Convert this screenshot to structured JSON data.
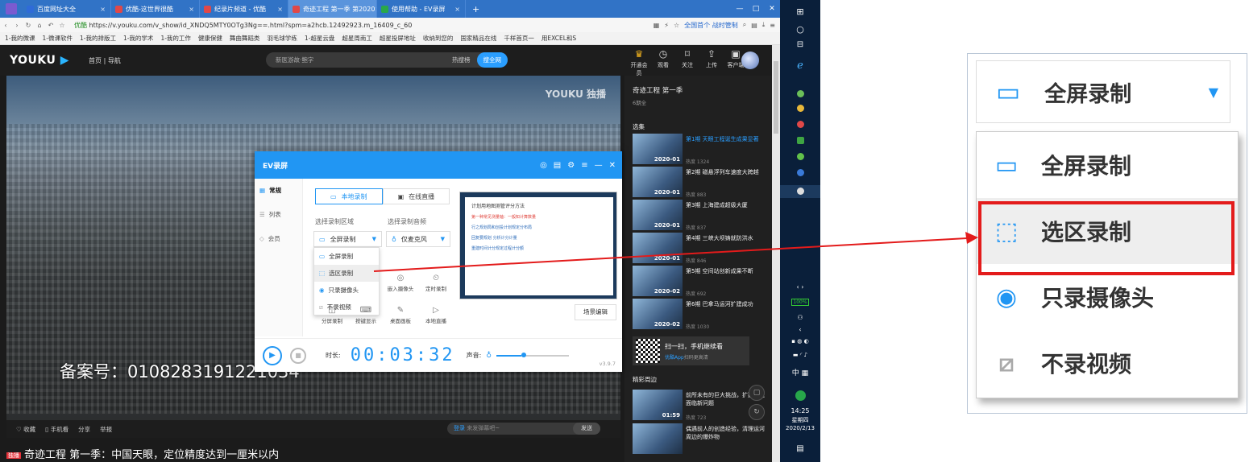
{
  "browser": {
    "tabs": [
      {
        "label": "百度网址大全",
        "color": "#2f6bd8",
        "active": false
      },
      {
        "label": "优酷-这世界很酷",
        "color": "#e04848",
        "active": false
      },
      {
        "label": "纪录片频道 - 优酷",
        "color": "#e04848",
        "active": false
      },
      {
        "label": "奇迹工程 第一季 第2020",
        "color": "#e04848",
        "active": true
      },
      {
        "label": "使用帮助 - EV录屏",
        "color": "#2aa84a",
        "active": false
      }
    ],
    "new_tab": "+",
    "url_prefix": "优酷",
    "url": "https://v.youku.com/v_show/id_XNDQ5MTY0OTg3Ng==.html?spm=a2hcb.12492923.m_16409_c_60",
    "cast_label": "全国首个 战时管制",
    "bookmarks": [
      "1-我的微课",
      "1-微课软件",
      "1-我的排版工",
      "1-我的学术",
      "1-我的工作",
      "健康保健",
      "舞曲舞蹈类",
      "羽毛球学练",
      "1-超星云盘",
      "超星周南工",
      "超星投屏地址",
      "收纳到您的",
      "国家精品在线",
      "千样首页一",
      "用EXCEL和S"
    ]
  },
  "youku": {
    "logo": "YOUKU",
    "nav": "首页 | 导航",
    "search_placeholder": "新医游故·鲍字",
    "hot": "热搜榜",
    "search_btn": "搜全网",
    "header_icons": [
      "开通会员",
      "观看",
      "关注",
      "上传",
      "客户端"
    ],
    "watermark": "YOUKU 独播",
    "caption": "备案号：0108283191221034",
    "actions": [
      "收藏",
      "手机看",
      "分享",
      "举报"
    ],
    "danmu_login": "登录",
    "danmu_hint": "来发弹幕吧~",
    "danmu_send": "发送",
    "video_title_badge": "独播",
    "video_title": "奇迹工程 第一季：中国天眼，定位精度达到一厘米以内"
  },
  "sidebar": {
    "title": "奇迹工程 第一季",
    "subtitle": "6期全",
    "section": "选集",
    "episodes": [
      {
        "title": "第1期 天眼工程诞生成果显著",
        "date": "2020-01",
        "heat": "热度 1324",
        "current": true
      },
      {
        "title": "第2期 磁悬浮列车速度大跨越",
        "date": "2020-01",
        "heat": "热度 883",
        "current": false
      },
      {
        "title": "第3期 上海建成超级大厦",
        "date": "2020-01",
        "heat": "热度 837",
        "current": false
      },
      {
        "title": "第4期 三峡大坝铸就防洪水",
        "date": "2020-01",
        "heat": "热度 846",
        "current": false
      },
      {
        "title": "第5期 空间站创新成果不断",
        "date": "2020-02",
        "heat": "热度 692",
        "current": false
      },
      {
        "title": "第6期 巴拿马运河扩建成功",
        "date": "2020-02",
        "heat": "热度 1030",
        "current": false
      }
    ],
    "qr_main": "扫一扫，手机继续看",
    "qr_sub_link": "优酷App",
    "qr_sub": "扫码更高清",
    "section2": "精彩周边",
    "related": [
      {
        "title": "前所未有的巨大挑战，扩建工程面临新问题",
        "date": "01:59",
        "heat": "热度 723"
      },
      {
        "title": "偶遇前人的创造经验，清理运河周边的爆炸物",
        "date": "",
        "heat": ""
      }
    ]
  },
  "ev": {
    "title": "EV录屏",
    "left_menu": [
      "常规",
      "列表",
      "会员"
    ],
    "tabs": [
      "本地录制",
      "在线直播"
    ],
    "area_label": "选择录制区域",
    "audio_label": "选择录制音频",
    "area_value": "全屏录制",
    "audio_value": "仅麦克风",
    "area_options": [
      "全屏录制",
      "选区录制",
      "只录摄像头",
      "不录视频"
    ],
    "tools": [
      "嵌入摄像头",
      "定时录制",
      "分屏录制",
      "按键显示",
      "桌面画板",
      "本地直播"
    ],
    "preview_title": "计划用地图测管评分方法",
    "preview_lines": [
      "第一种常见测量轴：一般知计算数量",
      "行之规划局和创投计划规定分布局",
      "回复要规划 分析计分计量",
      "重建时间计分规定过程计分额"
    ],
    "scene_btn": "场景编辑",
    "duration_label": "时长:",
    "time": "00:03:32",
    "volume_label": "声音:",
    "volume_level": 0.35,
    "version": "v3.9.7"
  },
  "tray": {
    "battery": "100%",
    "lang": "中",
    "time": "14:25",
    "weekday": "星期四",
    "date": "2020/2/13"
  },
  "zoom": {
    "selected": "全屏录制",
    "options": [
      "全屏录制",
      "选区录制",
      "只录摄像头",
      "不录视频"
    ],
    "highlight_color": "#e31b1b"
  }
}
